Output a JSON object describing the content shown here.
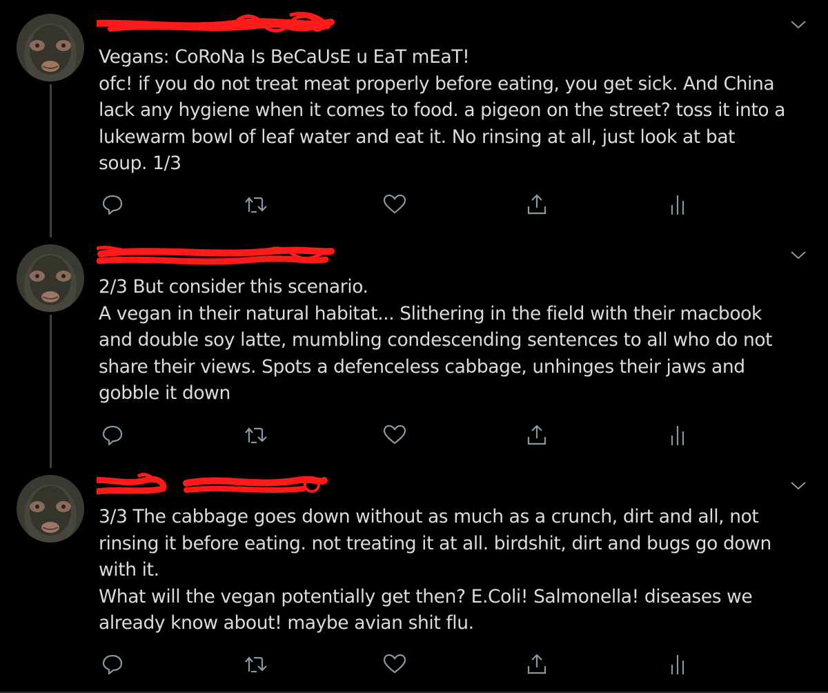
{
  "colors": {
    "background": "#000000",
    "text": "#dcdcdc",
    "icon": "#8899a6",
    "thread_line": "#3d4147",
    "redaction": "#ff1a1a"
  },
  "icons": {
    "reply": "reply-icon",
    "retweet": "retweet-icon",
    "like": "heart-icon",
    "share": "share-icon",
    "analytics": "analytics-icon",
    "more": "chevron-down-icon"
  },
  "tweets": [
    {
      "lines": [
        "Vegans: CoRoNa Is BeCaUsE u EaT mEaT!",
        "ofc! if you do not treat meat properly before eating, you get sick. And China",
        "lack any hygiene when it comes to food. a pigeon on the street? toss it into a",
        "lukewarm bowl of leaf water and eat it. No rinsing at all, just look at bat",
        "soup. 1/3"
      ]
    },
    {
      "lines": [
        "2/3 But consider this scenario.",
        "A vegan in their natural habitat... Slithering in the field with their macbook",
        "and double soy latte, mumbling condescending sentences to all who do not",
        "share their views. Spots a defenceless cabbage, unhinges their jaws and",
        "gobble it down"
      ]
    },
    {
      "lines": [
        "3/3 The cabbage goes down without as much as a crunch, dirt and all, not",
        "rinsing it before eating. not treating it at all. birdshit, dirt and bugs go down",
        "with it.",
        "What will the vegan potentially get then? E.Coli! Salmonella! diseases we",
        "already know about! maybe avian shit flu."
      ]
    }
  ]
}
